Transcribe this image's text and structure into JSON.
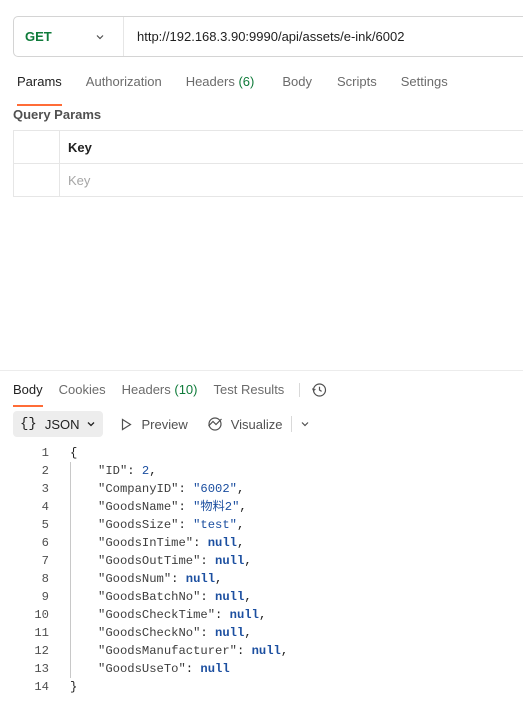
{
  "request": {
    "method": "GET",
    "url": "http://192.168.3.90:9990/api/assets/e-ink/6002",
    "tabs": [
      {
        "label": "Params"
      },
      {
        "label": "Authorization"
      },
      {
        "label": "Headers",
        "count": "(6)"
      },
      {
        "label": "Body"
      },
      {
        "label": "Scripts"
      },
      {
        "label": "Settings"
      }
    ],
    "active_tab": "Params"
  },
  "query_params": {
    "title": "Query Params",
    "column_header": "Key",
    "key_placeholder": "Key"
  },
  "response": {
    "tabs": [
      {
        "label": "Body"
      },
      {
        "label": "Cookies"
      },
      {
        "label": "Headers",
        "count": "(10)"
      },
      {
        "label": "Test Results"
      }
    ],
    "active_tab": "Body",
    "format": "JSON",
    "format_icon": "{}",
    "preview_label": "Preview",
    "visualize_label": "Visualize",
    "lines": [
      {
        "n": "1",
        "open": "{"
      },
      {
        "n": "2",
        "key": "\"ID\"",
        "value": "2",
        "type": "num"
      },
      {
        "n": "3",
        "key": "\"CompanyID\"",
        "value": "\"6002\"",
        "type": "str"
      },
      {
        "n": "4",
        "key": "\"GoodsName\"",
        "value": "\"物料2\"",
        "type": "str"
      },
      {
        "n": "5",
        "key": "\"GoodsSize\"",
        "value": "\"test\"",
        "type": "str"
      },
      {
        "n": "6",
        "key": "\"GoodsInTime\"",
        "value": "null",
        "type": "null"
      },
      {
        "n": "7",
        "key": "\"GoodsOutTime\"",
        "value": "null",
        "type": "null"
      },
      {
        "n": "8",
        "key": "\"GoodsNum\"",
        "value": "null",
        "type": "null"
      },
      {
        "n": "9",
        "key": "\"GoodsBatchNo\"",
        "value": "null",
        "type": "null"
      },
      {
        "n": "10",
        "key": "\"GoodsCheckTime\"",
        "value": "null",
        "type": "null"
      },
      {
        "n": "11",
        "key": "\"GoodsCheckNo\"",
        "value": "null",
        "type": "null"
      },
      {
        "n": "12",
        "key": "\"GoodsManufacturer\"",
        "value": "null",
        "type": "null"
      },
      {
        "n": "13",
        "key": "\"GoodsUseTo\"",
        "value": "null",
        "type": "null",
        "last": true
      },
      {
        "n": "14",
        "close": "}"
      }
    ]
  },
  "colors": {
    "accent": "#ff6c37",
    "method_get": "#0f7b3a",
    "json_value": "#1c4fa0"
  }
}
